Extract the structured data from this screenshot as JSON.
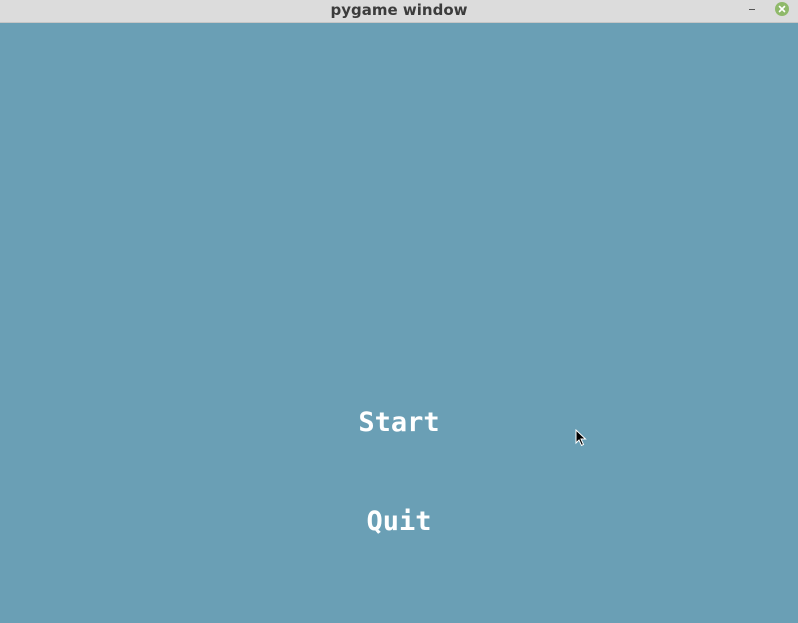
{
  "window": {
    "title": "pygame window",
    "background_color": "#6a9fb5"
  },
  "titlebar": {
    "minimize_icon": "minimize-icon",
    "close_icon": "close-icon"
  },
  "menu": {
    "items": [
      {
        "label": "Start"
      },
      {
        "label": "Quit"
      }
    ],
    "text_color": "#ffffff"
  }
}
